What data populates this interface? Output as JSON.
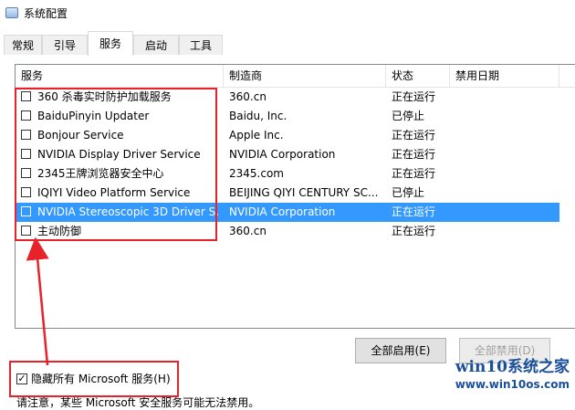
{
  "window": {
    "title": "系统配置"
  },
  "tabs": [
    "常规",
    "引导",
    "服务",
    "启动",
    "工具"
  ],
  "active_tab": "服务",
  "columns": [
    "服务",
    "制造商",
    "状态",
    "禁用日期"
  ],
  "rows": [
    {
      "name": "360 杀毒实时防护加载服务",
      "vendor": "360.cn",
      "status": "正在运行",
      "date": "",
      "checked": false,
      "selected": false
    },
    {
      "name": "BaiduPinyin Updater",
      "vendor": "Baidu, Inc.",
      "status": "已停止",
      "date": "",
      "checked": false,
      "selected": false
    },
    {
      "name": "Bonjour Service",
      "vendor": "Apple Inc.",
      "status": "正在运行",
      "date": "",
      "checked": false,
      "selected": false
    },
    {
      "name": "NVIDIA Display Driver Service",
      "vendor": "NVIDIA Corporation",
      "status": "正在运行",
      "date": "",
      "checked": false,
      "selected": false
    },
    {
      "name": "2345王牌浏览器安全中心",
      "vendor": "2345.com",
      "status": "正在运行",
      "date": "",
      "checked": false,
      "selected": false
    },
    {
      "name": "IQIYI Video Platform Service",
      "vendor": "BEIJING QIYI CENTURY SC...",
      "status": "已停止",
      "date": "",
      "checked": false,
      "selected": false
    },
    {
      "name": "NVIDIA Stereoscopic 3D Driver S...",
      "vendor": "NVIDIA Corporation",
      "status": "正在运行",
      "date": "",
      "checked": false,
      "selected": true
    },
    {
      "name": "主动防御",
      "vendor": "360.cn",
      "status": "正在运行",
      "date": "",
      "checked": false,
      "selected": false
    }
  ],
  "note": "请注意，某些 Microsoft 安全服务可能无法禁用。",
  "buttons": {
    "enable_all": "全部启用(E)",
    "disable_all": "全部禁用(D)"
  },
  "hide_ms": {
    "label": "隐藏所有 Microsoft 服务(H)",
    "checked": true
  },
  "watermark": {
    "title": "win10系统之家",
    "url": "www.win10os.com"
  },
  "colors": {
    "selection": "#3399ff",
    "annotation": "#e8222a",
    "watermark": "#1a4f9c"
  }
}
